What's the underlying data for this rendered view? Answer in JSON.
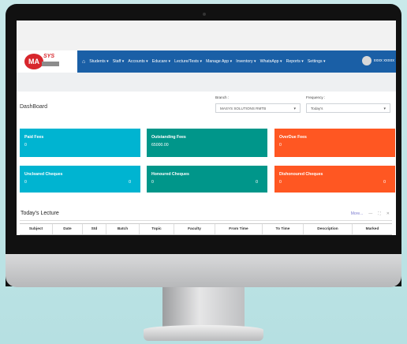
{
  "nav": {
    "logo_text": "MA",
    "logo_sub": "SYS",
    "items": [
      "Students ▾",
      "Staff ▾",
      "Accounts ▾",
      "Educare ▾",
      "Lecture/Tests ▾",
      "Manage App ▾",
      "Inventory ▾",
      "WhatsApp ▾",
      "Reports ▾",
      "Settings ▾"
    ],
    "user_name": "xxxx xxxxx"
  },
  "dashboard": {
    "title": "DashBoard",
    "branch_label": "Branch :",
    "branch_value": "MASYS SOLUTIONS RMTB",
    "frequency_label": "Frequency :",
    "frequency_value": "Today's"
  },
  "tiles": [
    {
      "label": "Paid Fees",
      "value": "0",
      "value2": "",
      "color": "#00b4d1"
    },
    {
      "label": "Outstanding Fees",
      "value": "65000.00",
      "value2": "",
      "color": "#00968a"
    },
    {
      "label": "OverDue Fees",
      "value": "0",
      "value2": "",
      "color": "#ff5722"
    },
    {
      "label": "Uncleared Cheques",
      "value": "0",
      "value2": "0",
      "color": "#00b4d1"
    },
    {
      "label": "Honoured Cheques",
      "value": "0",
      "value2": "0",
      "color": "#00968a"
    },
    {
      "label": "Dishonoured Cheques",
      "value": "0",
      "value2": "0",
      "color": "#ff5722"
    }
  ],
  "lecture": {
    "title": "Today's Lecture",
    "more_label": "More...",
    "columns": [
      "Subject",
      "Date",
      "Std",
      "Batch",
      "Topic",
      "Faculty",
      "From Time",
      "To Time",
      "Description",
      "Marked"
    ]
  }
}
